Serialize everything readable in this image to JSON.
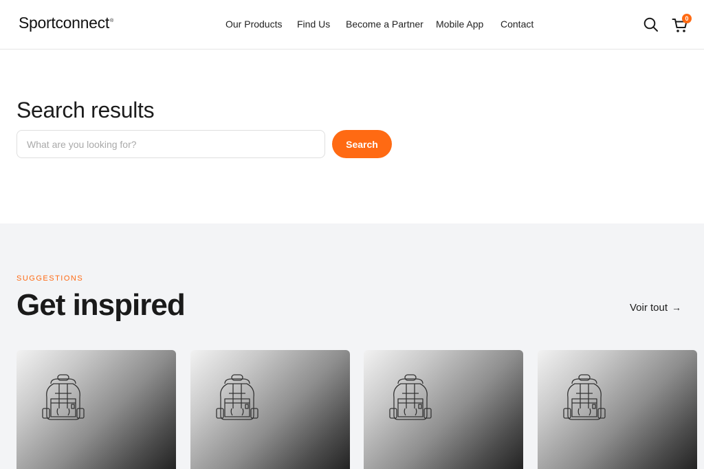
{
  "header": {
    "logo": "Sportconnect",
    "logo_tm": "®",
    "nav": [
      "Our Products",
      "Find Us",
      "Become a Partner",
      "Mobile App",
      "Contact"
    ],
    "search_icon": "search-icon",
    "cart_icon": "cart-icon",
    "cart_count": "0"
  },
  "search": {
    "title": "Search results",
    "placeholder": "What are you looking for?",
    "value": "",
    "button": "Search"
  },
  "suggestions": {
    "eyebrow": "SUGGESTIONS",
    "title": "Get inspired",
    "see_all": "Voir tout",
    "see_all_icon": "arrow-right-icon",
    "cards": [
      {
        "icon": "backpack-icon"
      },
      {
        "icon": "backpack-icon"
      },
      {
        "icon": "backpack-icon"
      },
      {
        "icon": "backpack-icon"
      }
    ]
  },
  "colors": {
    "accent": "#ff6a13",
    "section_bg": "#f3f4f6",
    "text": "#1a1a1a"
  }
}
